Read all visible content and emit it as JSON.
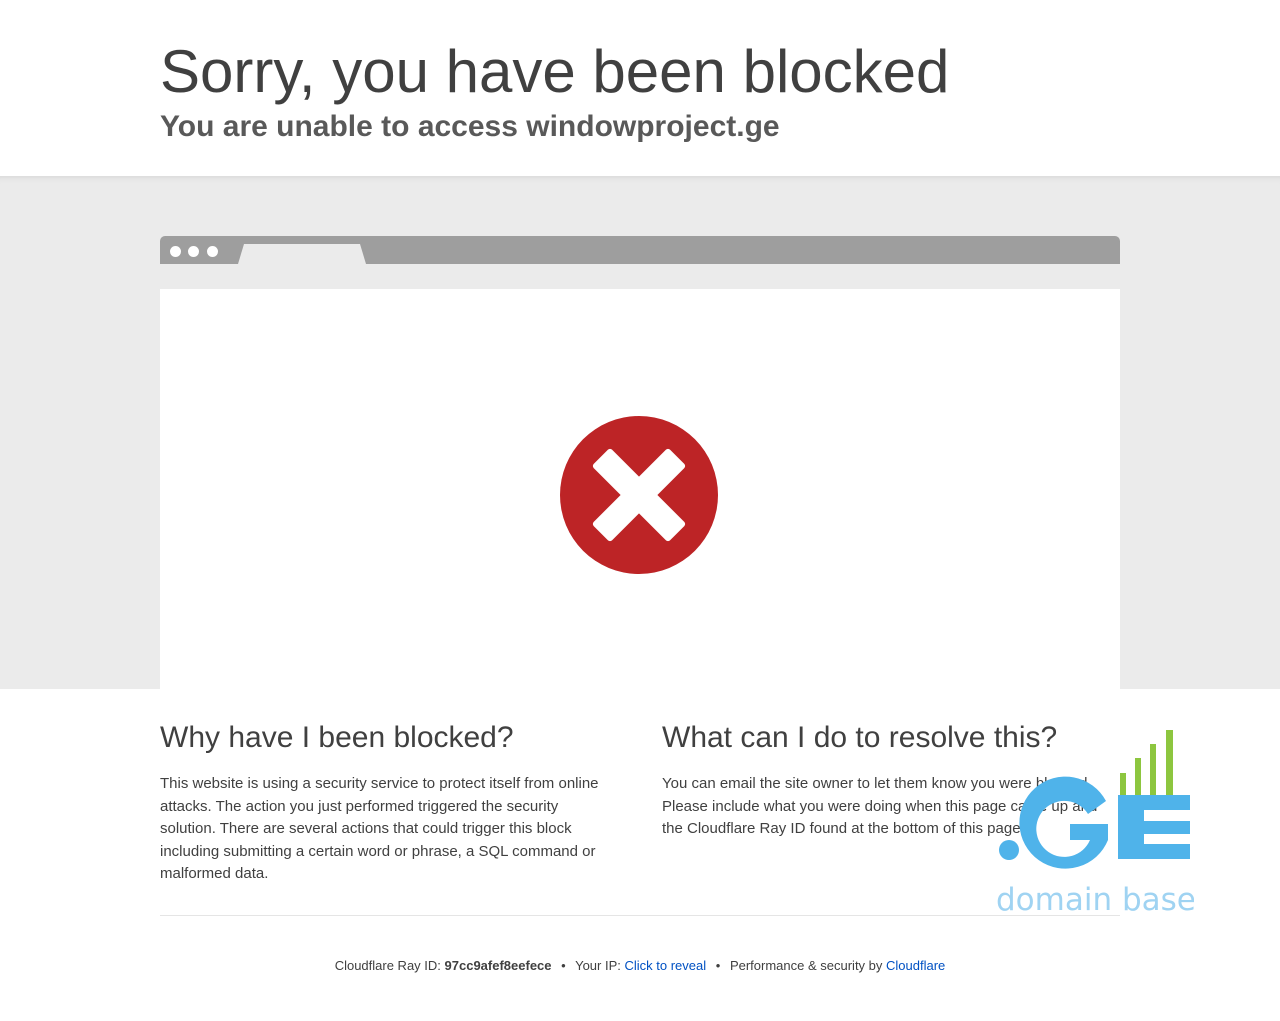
{
  "header": {
    "title": "Sorry, you have been blocked",
    "subtitle": "You are unable to access windowproject.ge"
  },
  "why": {
    "heading": "Why have I been blocked?",
    "body": "This website is using a security service to protect itself from online attacks. The action you just performed triggered the security solution. There are several actions that could trigger this block including submitting a certain word or phrase, a SQL command or malformed data."
  },
  "resolve": {
    "heading": "What can I do to resolve this?",
    "body": "You can email the site owner to let them know you were blocked. Please include what you were doing when this page came up and the Cloudflare Ray ID found at the bottom of this page."
  },
  "footer": {
    "ray_label": "Cloudflare Ray ID:",
    "ray_id": "97cc9afef8eefece",
    "separator": "•",
    "ip_label": "Your IP:",
    "ip_link": "Click to reveal",
    "perf_label": "Performance & security by",
    "perf_link": "Cloudflare"
  },
  "logo": {
    "mark": ".GE",
    "tagline": "domain base"
  },
  "icons": {
    "error": "error-x-icon",
    "browser_dots": "window-dots-icon"
  },
  "colors": {
    "error_red": "#bd2426",
    "link_blue": "#0051c3",
    "logo_blue": "#4fb3ea",
    "logo_green": "#8dc63f",
    "logo_tagline": "#9fd3f2"
  }
}
